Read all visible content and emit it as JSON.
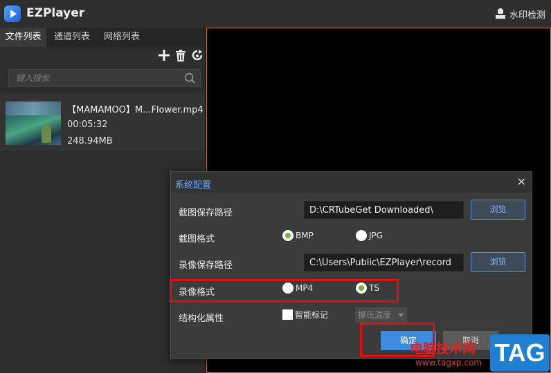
{
  "app": {
    "title": "EZPlayer",
    "watermark_check": "水印检测"
  },
  "tabs": [
    {
      "label": "文件列表",
      "active": true
    },
    {
      "label": "通道列表",
      "active": false
    },
    {
      "label": "网络列表",
      "active": false
    }
  ],
  "toolbar": {
    "icons": [
      "add-icon",
      "delete-icon",
      "refresh-icon"
    ]
  },
  "search": {
    "placeholder": "键入搜索",
    "value": ""
  },
  "files": [
    {
      "name": "【MAMAMOO】M...Flower.mp4",
      "duration": "00:05:32",
      "size": "248.94MB"
    }
  ],
  "dialog": {
    "title": "系统配置",
    "close": "×",
    "screenshot_path_label": "截图保存路径",
    "screenshot_path_value": "D:\\CRTubeGet Downloaded\\",
    "browse_label": "浏览",
    "screenshot_format_label": "截图格式",
    "screenshot_formats": [
      {
        "label": "BMP",
        "checked": true
      },
      {
        "label": "JPG",
        "checked": false
      }
    ],
    "record_path_label": "录像保存路径",
    "record_path_value": "C:\\Users\\Public\\EZPlayer\\record",
    "record_format_label": "录像格式",
    "record_formats": [
      {
        "label": "MP4",
        "checked": false
      },
      {
        "label": "TS",
        "checked": true
      }
    ],
    "structured_label": "结构化属性",
    "smart_mark_label": "智能标记",
    "smart_mark_checked": false,
    "temperature_select": "摄氏温度",
    "ok_label": "确定",
    "cancel_label": "取消"
  },
  "watermark": {
    "site_name": "电脑技术网",
    "url": "www.tagxp.com",
    "tag": "TAG"
  },
  "colors": {
    "accent": "#3d8be0",
    "highlight": "#e01010",
    "radio_checked": "#7ab23a",
    "dialog_title": "#6aa8ff"
  }
}
